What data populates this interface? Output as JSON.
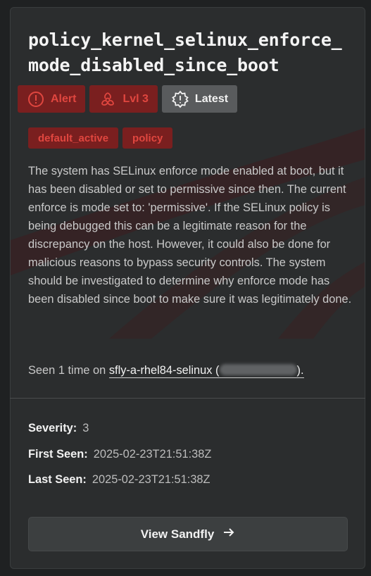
{
  "card": {
    "title": "policy_kernel_selinux_enforce_mode_disabled_since_boot",
    "badges": [
      {
        "label": "Alert",
        "icon": "alert-circle-icon",
        "style": "red"
      },
      {
        "label": "Lvl 3",
        "icon": "biohazard-icon",
        "style": "red"
      },
      {
        "label": "Latest",
        "icon": "gear-alert-icon",
        "style": "grey"
      }
    ],
    "tags": [
      "default_active",
      "policy"
    ],
    "description": "The system has SELinux enforce mode enabled at boot, but it has been disabled or set to permissive since then. The current enforce is mode set to: 'permissive'. If the SELinux policy is being debugged this can be a legitimate reason for the discrepancy on the host. However, it could also be done for malicious reasons to bypass security controls. The system should be investigated to determine why enforce mode has been disabled since boot to make sure it was legitimately done.",
    "seen": {
      "prefix": "Seen 1 time on",
      "host": "sfly-a-rhel84-selinux (",
      "suffix": ")."
    },
    "meta": {
      "severity_label": "Severity:",
      "severity_value": "3",
      "first_seen_label": "First Seen:",
      "first_seen_value": "2025-02-23T21:51:38Z",
      "last_seen_label": "Last Seen:",
      "last_seen_value": "2025-02-23T21:51:38Z"
    },
    "button": {
      "label": "View Sandfly",
      "icon": "arrow-right-icon"
    },
    "colors": {
      "alert_red": "#e0463f",
      "badge_red_bg": "#7a1f1f",
      "card_bg": "#2b2d2e"
    }
  }
}
